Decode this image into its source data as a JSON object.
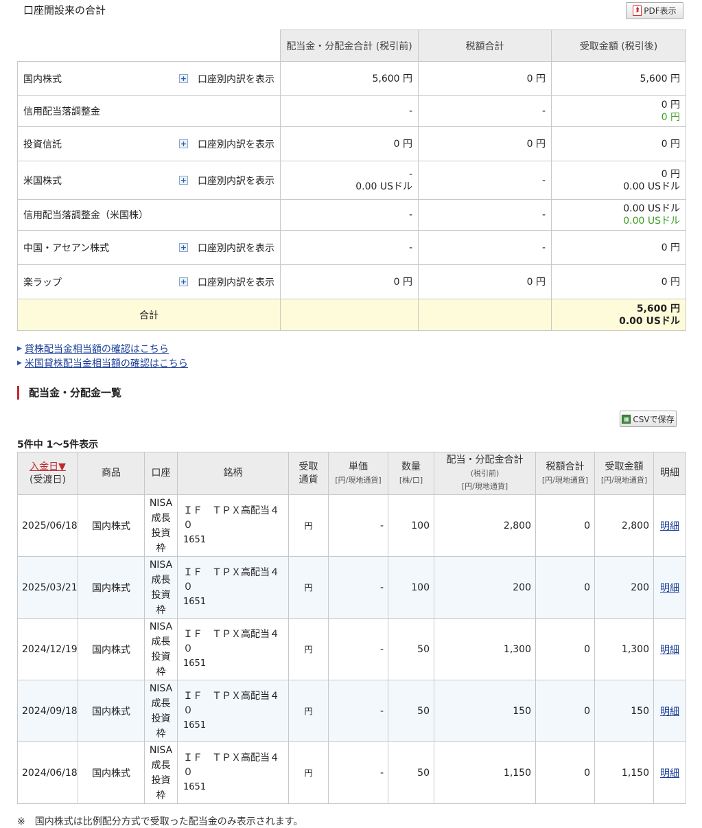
{
  "header": {
    "title": "口座開設来の合計",
    "pdf_label": "PDF表示"
  },
  "summary": {
    "columns": [
      "配当金・分配金合計 (税引前)",
      "税額合計",
      "受取金額 (税引後)"
    ],
    "detail_label": "口座別内訳を表示",
    "rows": [
      {
        "label": "国内株式",
        "gross": [
          "5,600 円"
        ],
        "tax": [
          "0 円"
        ],
        "net": [
          "5,600 円"
        ]
      },
      {
        "label": "信用配当落調整金",
        "gross": [
          "-"
        ],
        "tax": [
          "-"
        ],
        "net": [
          "0 円"
        ],
        "net_green": "0 円"
      },
      {
        "label": "投資信託",
        "gross": [
          "0 円"
        ],
        "tax": [
          "0 円"
        ],
        "net": [
          "0 円"
        ]
      },
      {
        "label": "米国株式",
        "gross": [
          "-",
          "0.00 USドル"
        ],
        "tax": [
          "-"
        ],
        "net": [
          "0 円",
          "0.00 USドル"
        ]
      },
      {
        "label": "信用配当落調整金（米国株）",
        "gross": [
          "-"
        ],
        "tax": [
          "-"
        ],
        "net": [
          "0.00 USドル"
        ],
        "net_green": "0.00 USドル"
      },
      {
        "label": "中国・アセアン株式",
        "gross": [
          "-"
        ],
        "tax": [
          "-"
        ],
        "net": [
          "0 円"
        ]
      },
      {
        "label": "楽ラップ",
        "gross": [
          "0 円"
        ],
        "tax": [
          "0 円"
        ],
        "net": [
          "0 円"
        ]
      }
    ],
    "total": {
      "label": "合計",
      "net_yen": "5,600 円",
      "net_usd": "0.00 USドル"
    }
  },
  "links": [
    "貸株配当金相当額の確認はこちら",
    "米国貸株配当金相当額の確認はこちら"
  ],
  "section": {
    "title": "配当金・分配金一覧",
    "csv_label": "CSVで保存",
    "count": "5件中 1〜5件表示"
  },
  "list": {
    "headers": {
      "date": "入金日▼",
      "date_sub": "(受渡日)",
      "product": "商品",
      "account": "口座",
      "name": "銘柄",
      "currency": "受取\n通貨",
      "price": "単価",
      "price_sub": "[円/現地通貨]",
      "qty": "数量",
      "qty_sub": "[株/口]",
      "gross": "配当・分配金合計",
      "gross_sub1": "(税引前)",
      "gross_sub2": "[円/現地通貨]",
      "tax": "税額合計",
      "tax_sub": "[円/現地通貨]",
      "net": "受取金額",
      "net_sub": "[円/現地通貨]",
      "detail": "明細"
    },
    "rows": [
      {
        "date": "2025/06/18",
        "product": "国内株式",
        "account": [
          "NISA",
          "成長",
          "投資",
          "枠"
        ],
        "name_lines": [
          "ＩＦ　ＴＰＸ高配当４",
          "０"
        ],
        "code": "1651",
        "currency": "円",
        "price": "-",
        "qty": "100",
        "gross": "2,800",
        "tax": "0",
        "net": "2,800",
        "detail": "明細"
      },
      {
        "date": "2025/03/21",
        "product": "国内株式",
        "account": [
          "NISA",
          "成長",
          "投資",
          "枠"
        ],
        "name_lines": [
          "ＩＦ　ＴＰＸ高配当４",
          "０"
        ],
        "code": "1651",
        "currency": "円",
        "price": "-",
        "qty": "100",
        "gross": "200",
        "tax": "0",
        "net": "200",
        "detail": "明細"
      },
      {
        "date": "2024/12/19",
        "product": "国内株式",
        "account": [
          "NISA",
          "成長",
          "投資",
          "枠"
        ],
        "name_lines": [
          "ＩＦ　ＴＰＸ高配当４",
          "０"
        ],
        "code": "1651",
        "currency": "円",
        "price": "-",
        "qty": "50",
        "gross": "1,300",
        "tax": "0",
        "net": "1,300",
        "detail": "明細"
      },
      {
        "date": "2024/09/18",
        "product": "国内株式",
        "account": [
          "NISA",
          "成長",
          "投資",
          "枠"
        ],
        "name_lines": [
          "ＩＦ　ＴＰＸ高配当４",
          "０"
        ],
        "code": "1651",
        "currency": "円",
        "price": "-",
        "qty": "50",
        "gross": "150",
        "tax": "0",
        "net": "150",
        "detail": "明細"
      },
      {
        "date": "2024/06/18",
        "product": "国内株式",
        "account": [
          "NISA",
          "成長",
          "投資",
          "枠"
        ],
        "name_lines": [
          "ＩＦ　ＴＰＸ高配当４",
          "０"
        ],
        "code": "1651",
        "currency": "円",
        "price": "-",
        "qty": "50",
        "gross": "1,150",
        "tax": "0",
        "net": "1,150",
        "detail": "明細"
      }
    ]
  },
  "footnote": "※　国内株式は比例配分方式で受取った配当金のみ表示されます。"
}
